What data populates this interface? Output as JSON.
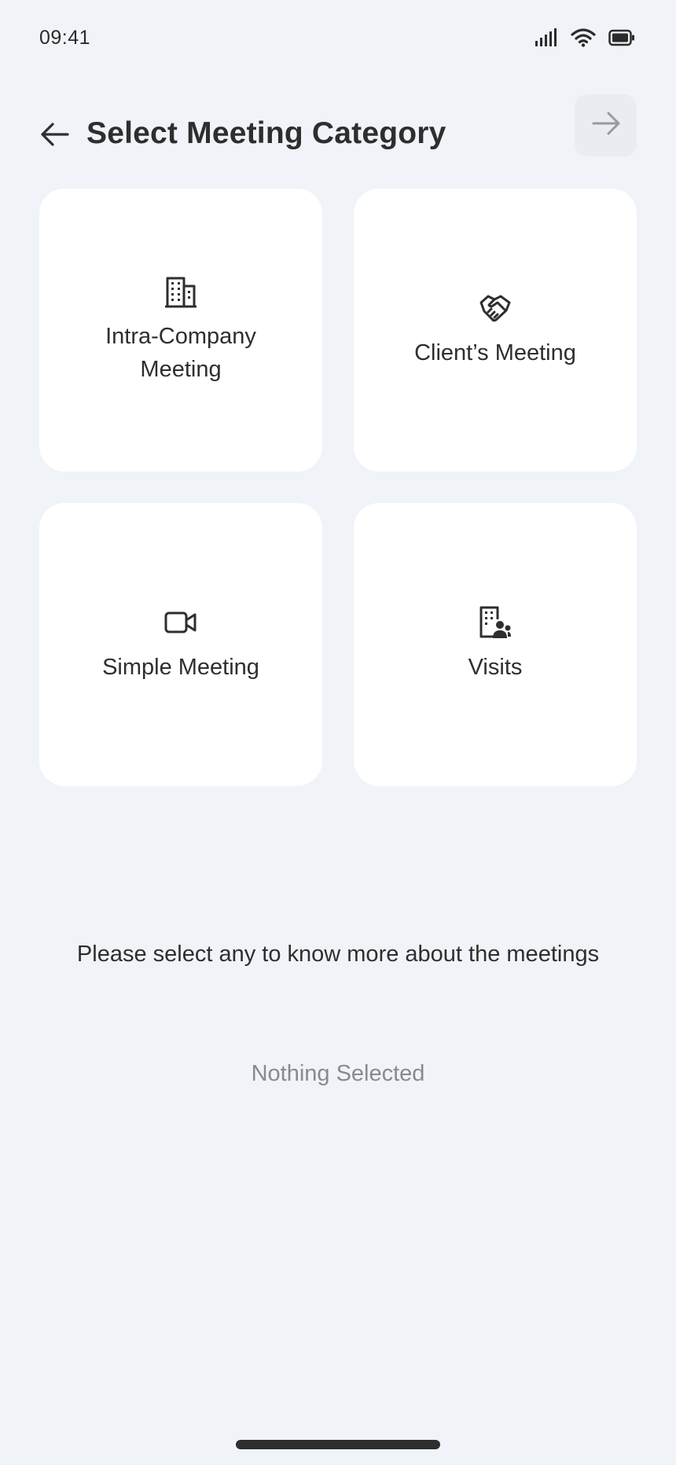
{
  "status_bar": {
    "time": "09:41",
    "icons": [
      "signal-icon",
      "wifi-icon",
      "battery-icon"
    ]
  },
  "header": {
    "title": "Select Meeting Category",
    "back_icon": "arrow-left-icon",
    "next_icon": "arrow-right-icon"
  },
  "categories": [
    {
      "label": "Intra-Company Meeting",
      "icon": "building-icon"
    },
    {
      "label": "Client’s Meeting",
      "icon": "handshake-icon"
    },
    {
      "label": "Simple Meeting",
      "icon": "video-camera-icon"
    },
    {
      "label": "Visits",
      "icon": "building-people-icon"
    }
  ],
  "hint": "Please select any to know more about the meetings",
  "selection_status": "Nothing Selected",
  "colors": {
    "background": "#f0f3f8",
    "card": "#ffffff",
    "text": "#2e2e2e",
    "muted_text": "#8a8a8a",
    "disabled_button": "#e9ecf0"
  }
}
